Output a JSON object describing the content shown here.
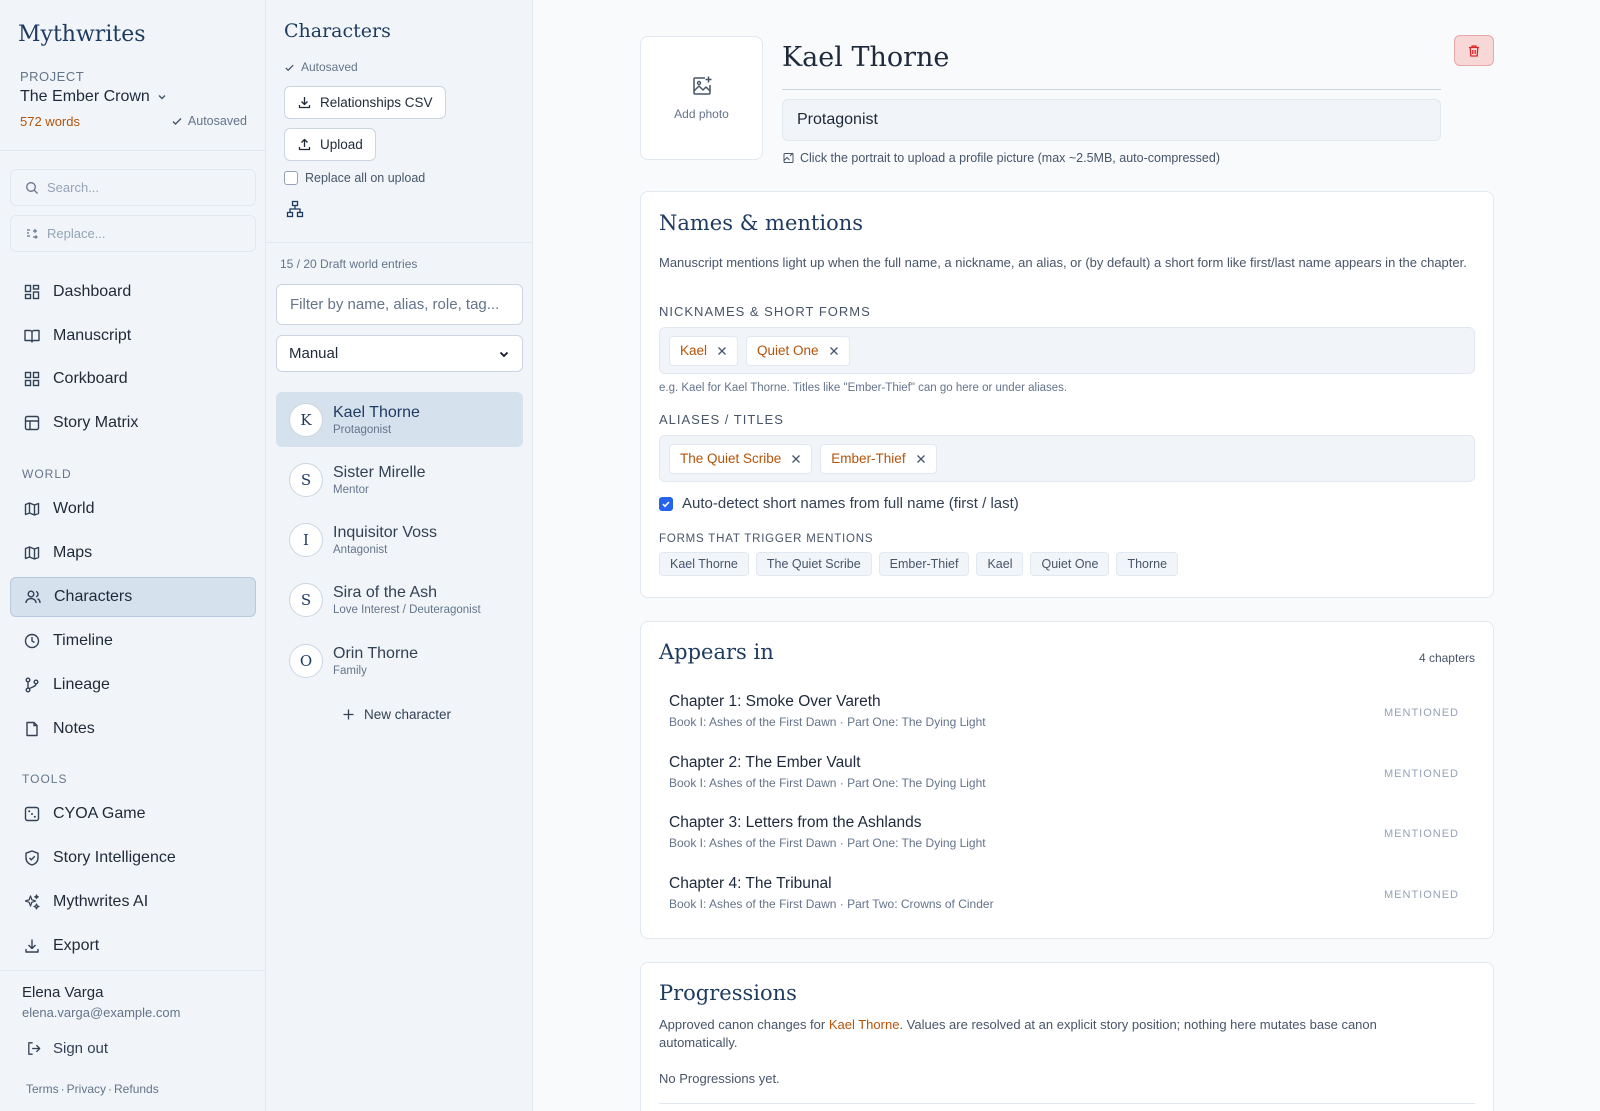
{
  "app": {
    "brand": "Mythwrites",
    "project_label": "PROJECT",
    "project_name": "The Ember Crown",
    "words": "572 words",
    "autosaved": "Autosaved"
  },
  "sidebar": {
    "search_placeholder": "Search...",
    "replace_placeholder": "Replace...",
    "main_items": [
      {
        "label": "Dashboard",
        "icon": "dashboard-icon"
      },
      {
        "label": "Manuscript",
        "icon": "book-open-icon"
      },
      {
        "label": "Corkboard",
        "icon": "grid-icon"
      },
      {
        "label": "Story Matrix",
        "icon": "table-icon"
      }
    ],
    "world_label": "WORLD",
    "world_items": [
      {
        "label": "World",
        "icon": "map-icon"
      },
      {
        "label": "Maps",
        "icon": "map-icon"
      },
      {
        "label": "Characters",
        "icon": "users-icon",
        "active": true
      },
      {
        "label": "Timeline",
        "icon": "clock-icon"
      },
      {
        "label": "Lineage",
        "icon": "git-branch-icon"
      },
      {
        "label": "Notes",
        "icon": "file-icon"
      }
    ],
    "tools_label": "TOOLS",
    "tools_items": [
      {
        "label": "CYOA Game",
        "icon": "dice-icon"
      },
      {
        "label": "Story Intelligence",
        "icon": "shield-icon"
      },
      {
        "label": "Mythwrites AI",
        "icon": "sparkles-icon"
      },
      {
        "label": "Export",
        "icon": "download-icon"
      }
    ],
    "user": {
      "name": "Elena Varga",
      "email": "elena.varga@example.com"
    },
    "sign_out": "Sign out",
    "legal": {
      "terms": "Terms",
      "privacy": "Privacy",
      "refunds": "Refunds",
      "sep": "·"
    }
  },
  "characters_panel": {
    "title": "Characters",
    "autosaved": "Autosaved",
    "relationships_csv": "Relationships CSV",
    "upload": "Upload",
    "replace_all": "Replace all on upload",
    "count": "15 / 20 Draft world entries",
    "filter_placeholder": "Filter by name, alias, role, tag...",
    "sort": "Manual",
    "list": [
      {
        "initial": "K",
        "name": "Kael Thorne",
        "role": "Protagonist",
        "active": true
      },
      {
        "initial": "S",
        "name": "Sister Mirelle",
        "role": "Mentor"
      },
      {
        "initial": "I",
        "name": "Inquisitor Voss",
        "role": "Antagonist"
      },
      {
        "initial": "S",
        "name": "Sira of the Ash",
        "role": "Love Interest / Deuteragonist"
      },
      {
        "initial": "O",
        "name": "Orin Thorne",
        "role": "Family"
      }
    ],
    "new_character": "New character"
  },
  "detail": {
    "add_photo": "Add photo",
    "name": "Kael Thorne",
    "role": "Protagonist",
    "photo_hint": "Click the portrait to upload a profile picture (max ~2.5MB, auto-compressed)",
    "names": {
      "title": "Names & mentions",
      "desc": "Manuscript mentions light up when the full name, a nickname, an alias, or (by default) a short form like first/last name appears in the chapter.",
      "nicknames_label": "NICKNAMES & SHORT FORMS",
      "nicknames": [
        "Kael",
        "Quiet One"
      ],
      "nick_hint": "e.g. Kael for Kael Thorne. Titles like \"Ember-Thief\" can go here or under aliases.",
      "aliases_label": "ALIASES / TITLES",
      "aliases": [
        "The Quiet Scribe",
        "Ember-Thief"
      ],
      "autodetect": "Auto-detect short names from full name (first / last)",
      "forms_label": "FORMS THAT TRIGGER MENTIONS",
      "forms": [
        "Kael Thorne",
        "The Quiet Scribe",
        "Ember-Thief",
        "Kael",
        "Quiet One",
        "Thorne"
      ]
    },
    "appears": {
      "title": "Appears in",
      "count": "4 chapters",
      "chapters": [
        {
          "title": "Chapter 1: Smoke Over Vareth",
          "sub": "Book I: Ashes of the First Dawn · Part One: The Dying Light",
          "tag": "MENTIONED"
        },
        {
          "title": "Chapter 2: The Ember Vault",
          "sub": "Book I: Ashes of the First Dawn · Part One: The Dying Light",
          "tag": "MENTIONED"
        },
        {
          "title": "Chapter 3: Letters from the Ashlands",
          "sub": "Book I: Ashes of the First Dawn · Part One: The Dying Light",
          "tag": "MENTIONED"
        },
        {
          "title": "Chapter 4: The Tribunal",
          "sub": "Book I: Ashes of the First Dawn · Part Two: Crowns of Cinder",
          "tag": "MENTIONED"
        }
      ]
    },
    "progressions": {
      "title": "Progressions",
      "desc_pre": "Approved canon changes for ",
      "desc_name": "Kael Thorne",
      "desc_post": ". Values are resolved at an explicit story position; nothing here mutates base canon automatically.",
      "empty": "No Progressions yet."
    }
  },
  "colors": {
    "accent": "#b45309",
    "brand": "#1e3a5f",
    "active_bg": "#d6e1ee",
    "danger": "#dc2626"
  }
}
